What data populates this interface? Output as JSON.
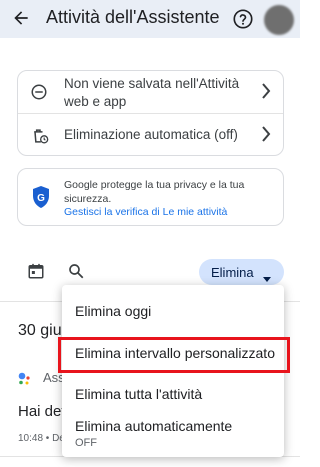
{
  "header": {
    "title": "Attività dell'Assistente"
  },
  "storage_card": {
    "not_saved_label": "Non viene salvata nell'Attività web e app",
    "auto_delete_label": "Eliminazione automatica (off)"
  },
  "privacy_card": {
    "text": "Google protegge la tua privacy e la tua sicurezza.",
    "link": "Gestisci la verifica di Le mie attività"
  },
  "toolbar": {
    "delete_label": "Elimina"
  },
  "feed": {
    "date_heading": "30 giu",
    "assistant_label": "Assi",
    "item_title": "Hai det",
    "item_meta": "10:48 • De"
  },
  "delete_menu": {
    "items": [
      "Elimina oggi",
      "Elimina intervallo personalizzato",
      "Elimina tutta l'attività",
      "Elimina automaticamente"
    ],
    "auto_delete_state": "OFF"
  },
  "colors": {
    "header_bg": "#e9eef6",
    "chip_bg": "#d3e3fd",
    "link": "#1a73e8",
    "highlight": "#e8141c"
  }
}
